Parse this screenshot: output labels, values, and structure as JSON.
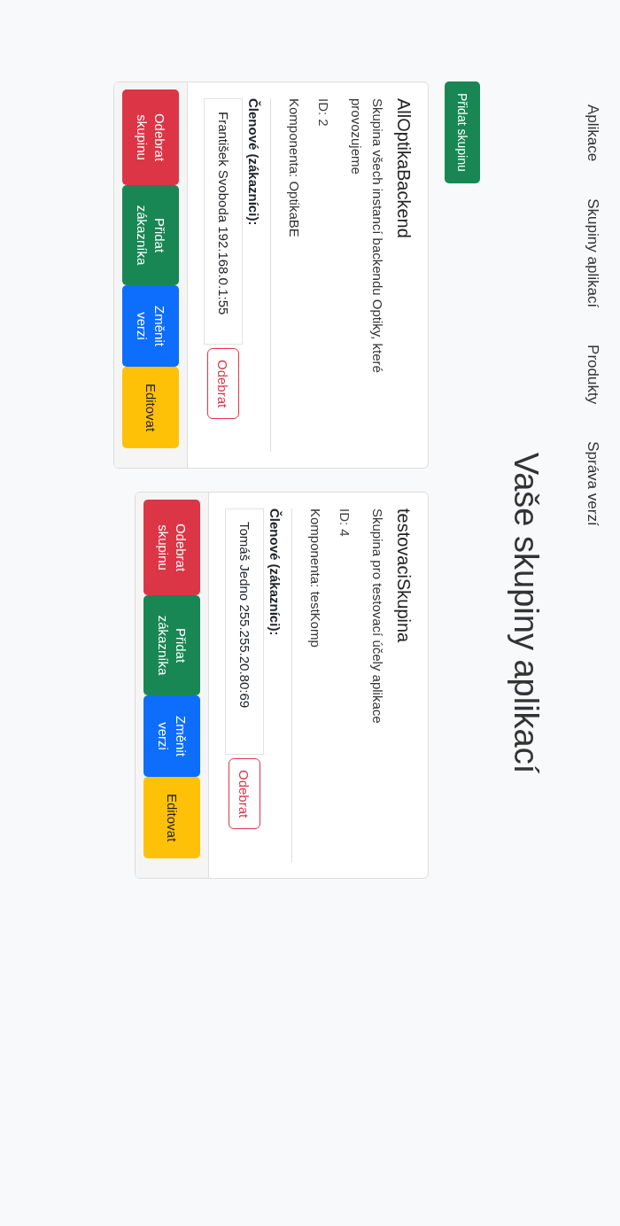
{
  "nav": {
    "items": [
      "Aplikace",
      "Skupiny aplikací",
      "Produkty",
      "Správa verzí"
    ]
  },
  "title": "Vaše skupiny aplikací",
  "add_button": "Přidat skupinu",
  "groups": [
    {
      "name": "AllOptikaBackend",
      "description": "Skupina všech instancí backendu Optiky, které provozujeme",
      "id": "ID: 2",
      "component": "Komponenta: OptikaBE",
      "members_label": "Členové (zákazníci):",
      "members": [
        {
          "text": "František Svoboda 192.168.0.1:55",
          "remove": "Odebrat"
        }
      ],
      "actions": [
        {
          "kind": "danger",
          "label": "Odebrat skupinu"
        },
        {
          "kind": "success",
          "label": "Přidat zákazníka"
        },
        {
          "kind": "primary",
          "label": "Změnit verzi"
        },
        {
          "kind": "warning",
          "label": "Editovat"
        }
      ]
    },
    {
      "name": "testovaciSkupina",
      "description": "Skupina pro testovací účely aplikace",
      "id": "ID: 4",
      "component": "Komponenta: testKomp",
      "members_label": "Členové (zákazníci):",
      "members": [
        {
          "text": "Tomáš Jedno 255.255.20.80:69",
          "remove": "Odebrat"
        }
      ],
      "actions": [
        {
          "kind": "danger",
          "label": "Odebrat skupinu"
        },
        {
          "kind": "success",
          "label": "Přidat zákazníka"
        },
        {
          "kind": "primary",
          "label": "Změnit verzi"
        },
        {
          "kind": "warning",
          "label": "Editovat"
        }
      ]
    }
  ]
}
